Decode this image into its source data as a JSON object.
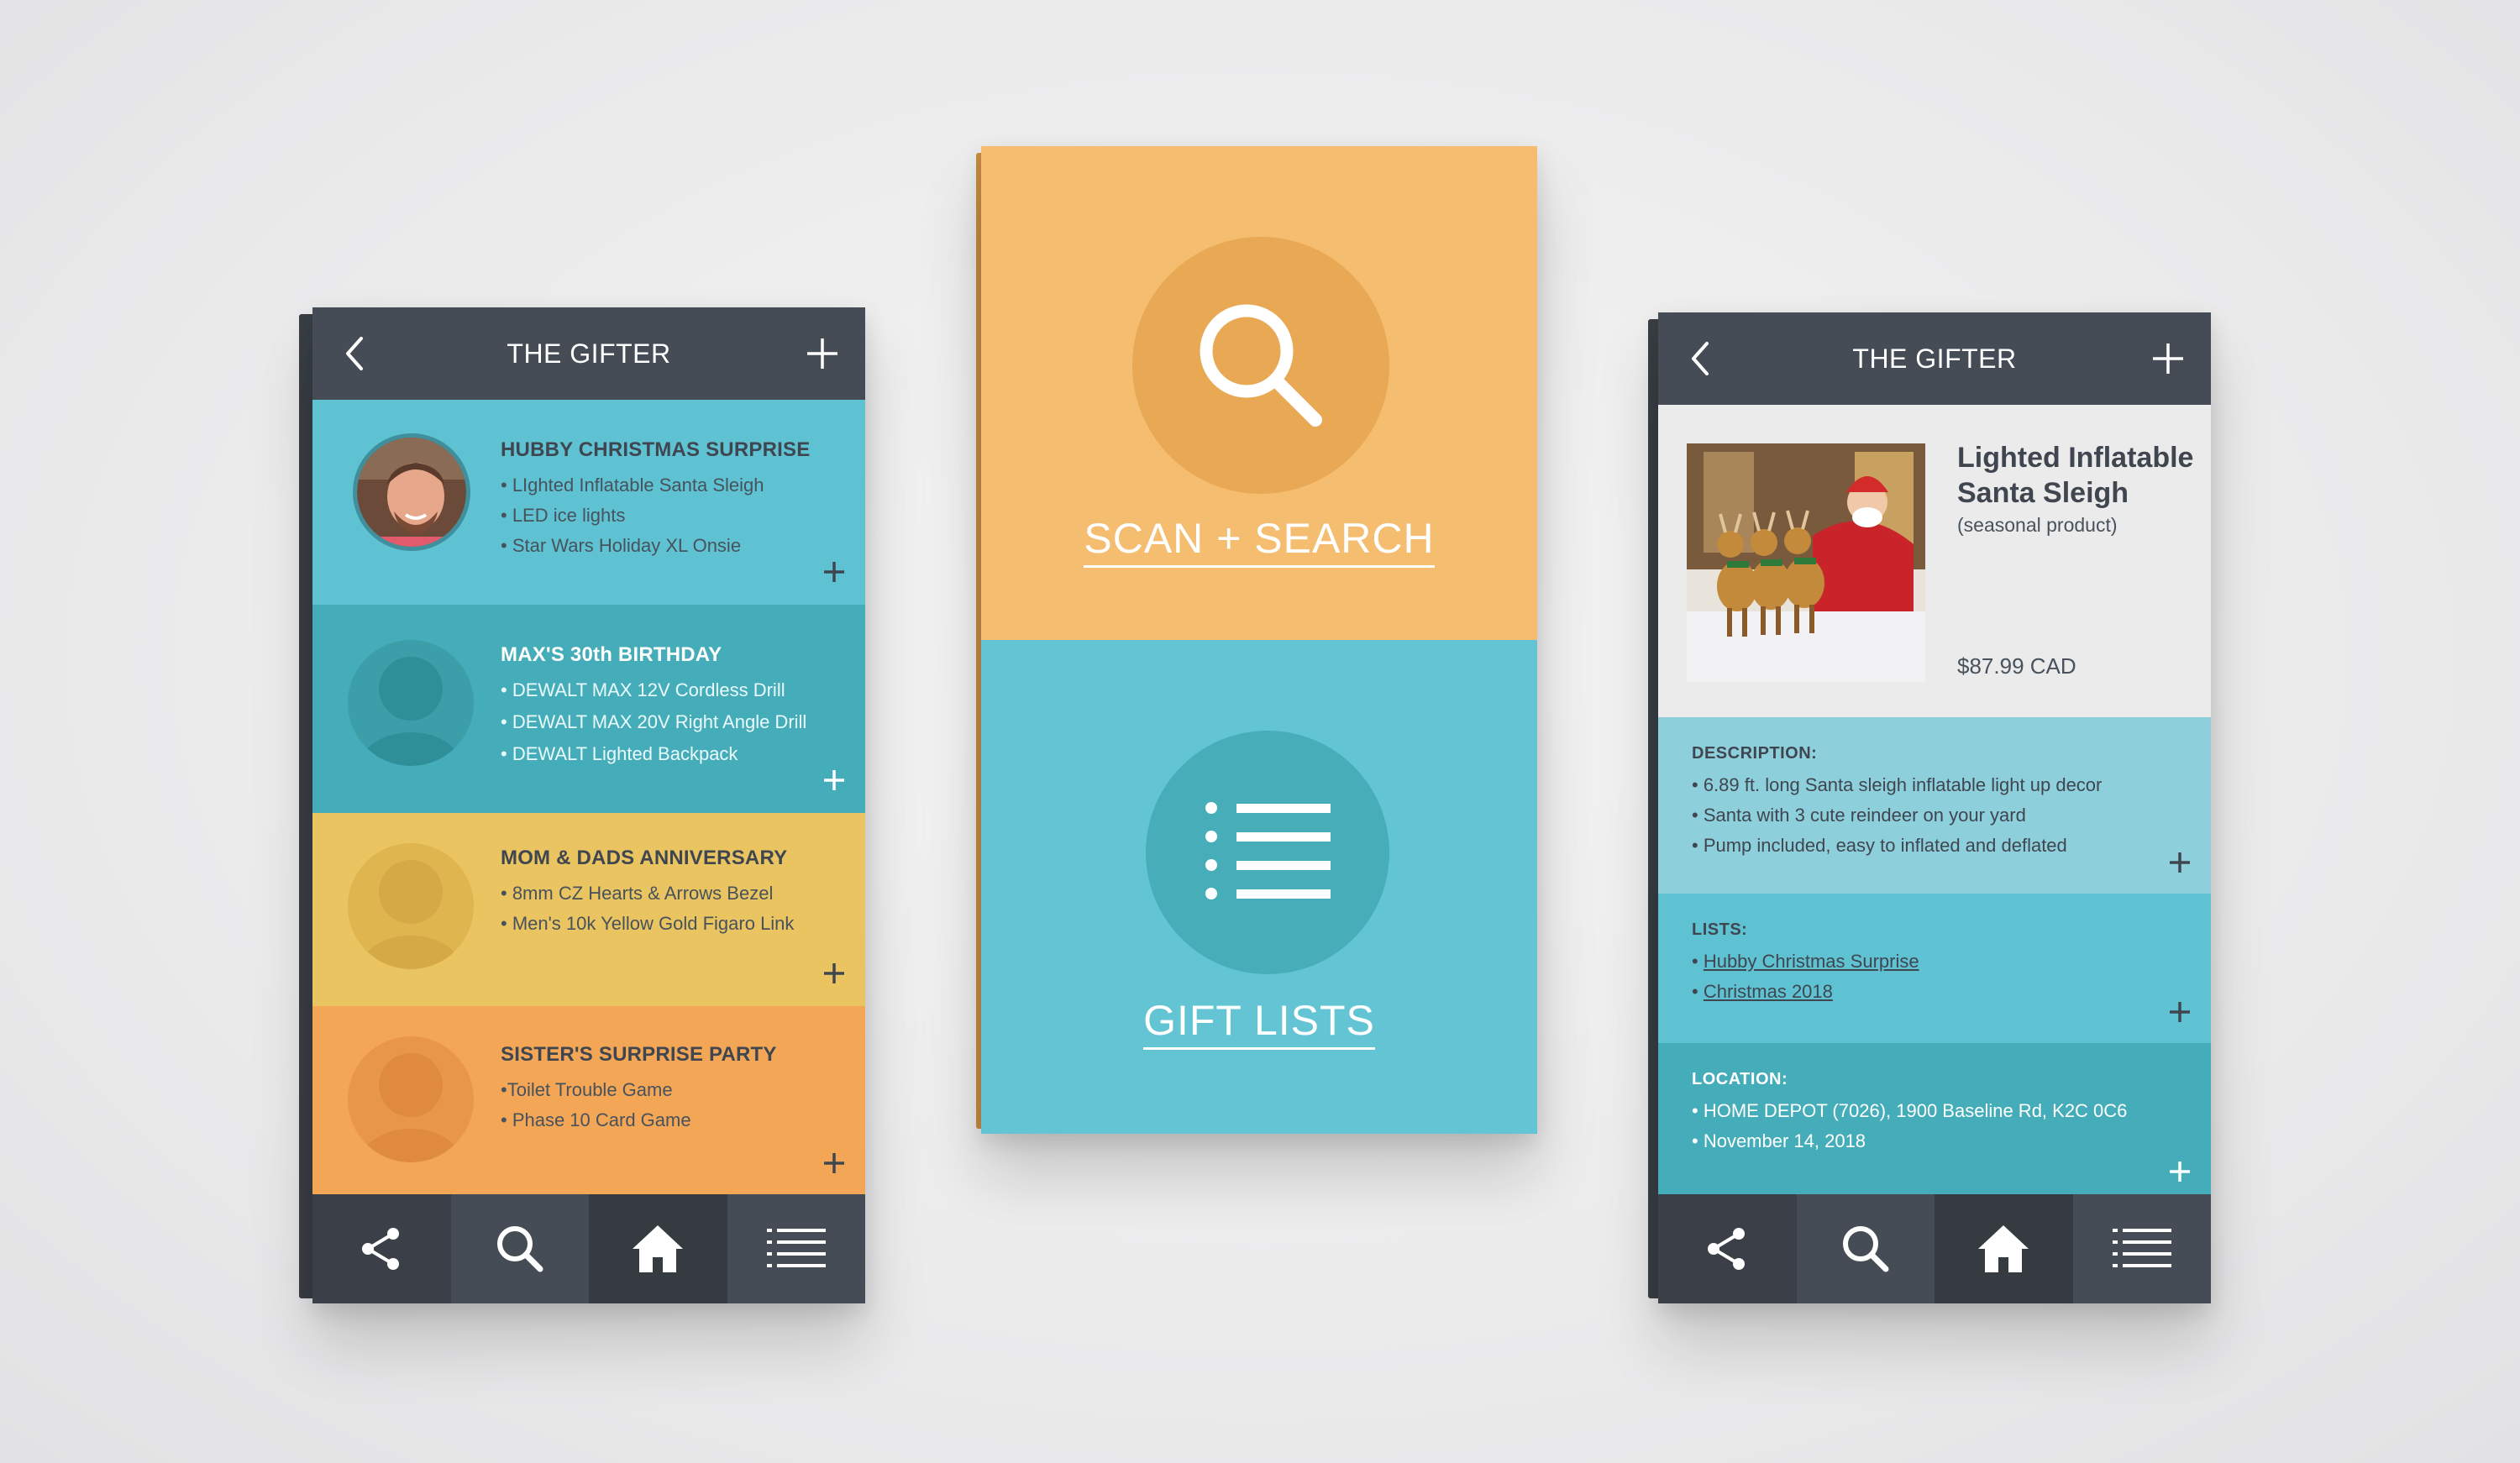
{
  "colors": {
    "header": "#464c55",
    "teal_light": "#5ec2d2",
    "teal": "#45adb9",
    "yellow": "#e9c461",
    "orange": "#f2a656",
    "peach": "#f4bd70",
    "light_gray": "#ebebec"
  },
  "left_phone": {
    "header": {
      "title": "THE GIFTER",
      "back_icon": "chevron-left-icon",
      "add_icon": "plus-icon"
    },
    "lists": [
      {
        "title": "HUBBY CHRISTMAS SURPRISE",
        "items": [
          "• LIghted Inflatable Santa Sleigh",
          "• LED ice lights",
          "• Star Wars Holiday XL Onsie"
        ],
        "avatar": "photo",
        "color": "#5ec2d2"
      },
      {
        "title": "MAX'S 30th BIRTHDAY",
        "items": [
          "• DEWALT MAX 12V Cordless Drill",
          "• DEWALT MAX 20V Right Angle Drill",
          "• DEWALT Lighted Backpack"
        ],
        "avatar": "placeholder",
        "color": "#45adb9"
      },
      {
        "title": "MOM & DADS ANNIVERSARY",
        "items": [
          "• 8mm CZ Hearts & Arrows Bezel",
          "• Men's 10k Yellow Gold Figaro Link"
        ],
        "avatar": "placeholder",
        "color": "#e9c461"
      },
      {
        "title": "SISTER'S SURPRISE PARTY",
        "items": [
          "•Toilet Trouble Game",
          "• Phase 10 Card Game"
        ],
        "avatar": "placeholder",
        "color": "#f2a656"
      }
    ],
    "nav": [
      "share-icon",
      "search-icon",
      "home-icon",
      "list-icon"
    ]
  },
  "center_phone": {
    "scan_label": "SCAN + SEARCH",
    "lists_label": "GIFT LISTS",
    "scan_icon": "magnifier-icon",
    "lists_icon": "bullet-list-icon"
  },
  "right_phone": {
    "header": {
      "title": "THE GIFTER",
      "back_icon": "chevron-left-icon",
      "add_icon": "plus-icon"
    },
    "product": {
      "name_line1": "Lighted Inflatable",
      "name_line2": "Santa Sleigh",
      "tag": "(seasonal product)",
      "price": "$87.99 CAD"
    },
    "description": {
      "label": "DESCRIPTION:",
      "items": [
        "• 6.89 ft. long Santa sleigh inflatable light up decor",
        "• Santa with 3 cute reindeer on your yard",
        "• Pump included, easy to inflated and deflated"
      ]
    },
    "lists": {
      "label": "LISTS:",
      "items": [
        "Hubby Christmas Surprise",
        "Christmas 2018"
      ]
    },
    "location": {
      "label": "LOCATION:",
      "items": [
        "• HOME DEPOT (7026), 1900 Baseline Rd, K2C 0C6",
        "• November 14, 2018"
      ]
    },
    "nav": [
      "share-icon",
      "search-icon",
      "home-icon",
      "list-icon"
    ]
  }
}
